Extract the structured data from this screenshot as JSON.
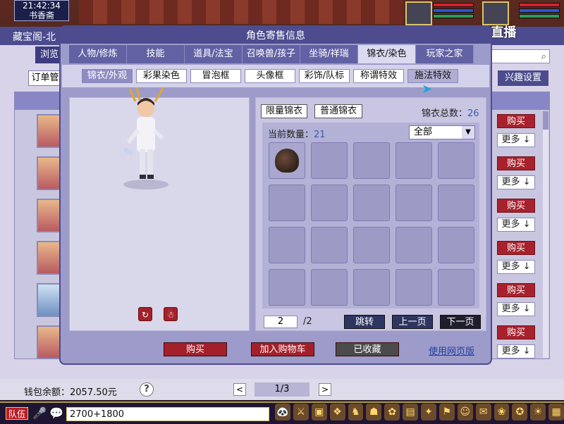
{
  "clock": {
    "time": "21:42:34",
    "location": "书香斋"
  },
  "watermark": "CC直播",
  "market": {
    "title": "藏宝阁-北",
    "tab_label": "浏览",
    "orders_label": "订单管",
    "interest_label": "兴趣设置",
    "buy_label": "购买",
    "more_label": "更多 ↓",
    "wallet": "钱包余额：2057.50元",
    "help": "?",
    "pager": {
      "prev": "<",
      "current": "1/3",
      "next": ">"
    }
  },
  "dialog": {
    "title": "角色寄售信息",
    "tabs": [
      {
        "label": "人物/修炼",
        "active": false
      },
      {
        "label": "技能",
        "active": false
      },
      {
        "label": "道具/法宝",
        "active": false
      },
      {
        "label": "召唤兽/孩子",
        "active": false
      },
      {
        "label": "坐骑/祥瑞",
        "active": false
      },
      {
        "label": "锦衣/染色",
        "active": true
      },
      {
        "label": "玩家之家",
        "active": false
      }
    ],
    "sub_tabs": [
      {
        "label": "锦衣/外观",
        "active": true
      },
      {
        "label": "彩果染色",
        "active": false
      },
      {
        "label": "冒泡框",
        "active": false
      },
      {
        "label": "头像框",
        "active": false
      },
      {
        "label": "彩饰/队标",
        "active": false
      },
      {
        "label": "称谓特效",
        "active": false
      },
      {
        "label": "施法特效",
        "active": false
      }
    ],
    "filters": {
      "limited": "限量锦衣",
      "normal": "普通锦衣"
    },
    "total": {
      "label": "锦衣总数：",
      "value": "26"
    },
    "count": {
      "label": "当前数量：",
      "value": "21"
    },
    "category": "全部",
    "pager": {
      "page": "2",
      "total": "/2",
      "jump": "跳转",
      "prev": "上一页",
      "next": "下一页"
    },
    "footer": {
      "buy": "购买",
      "add_cart": "加入购物车",
      "favorited": "已收藏",
      "web_link": "使用网页版"
    },
    "rotate_icon": "↻",
    "action_icon": "☃"
  },
  "taskbar": {
    "team": "队伍",
    "chat_value": "2700+1800"
  }
}
